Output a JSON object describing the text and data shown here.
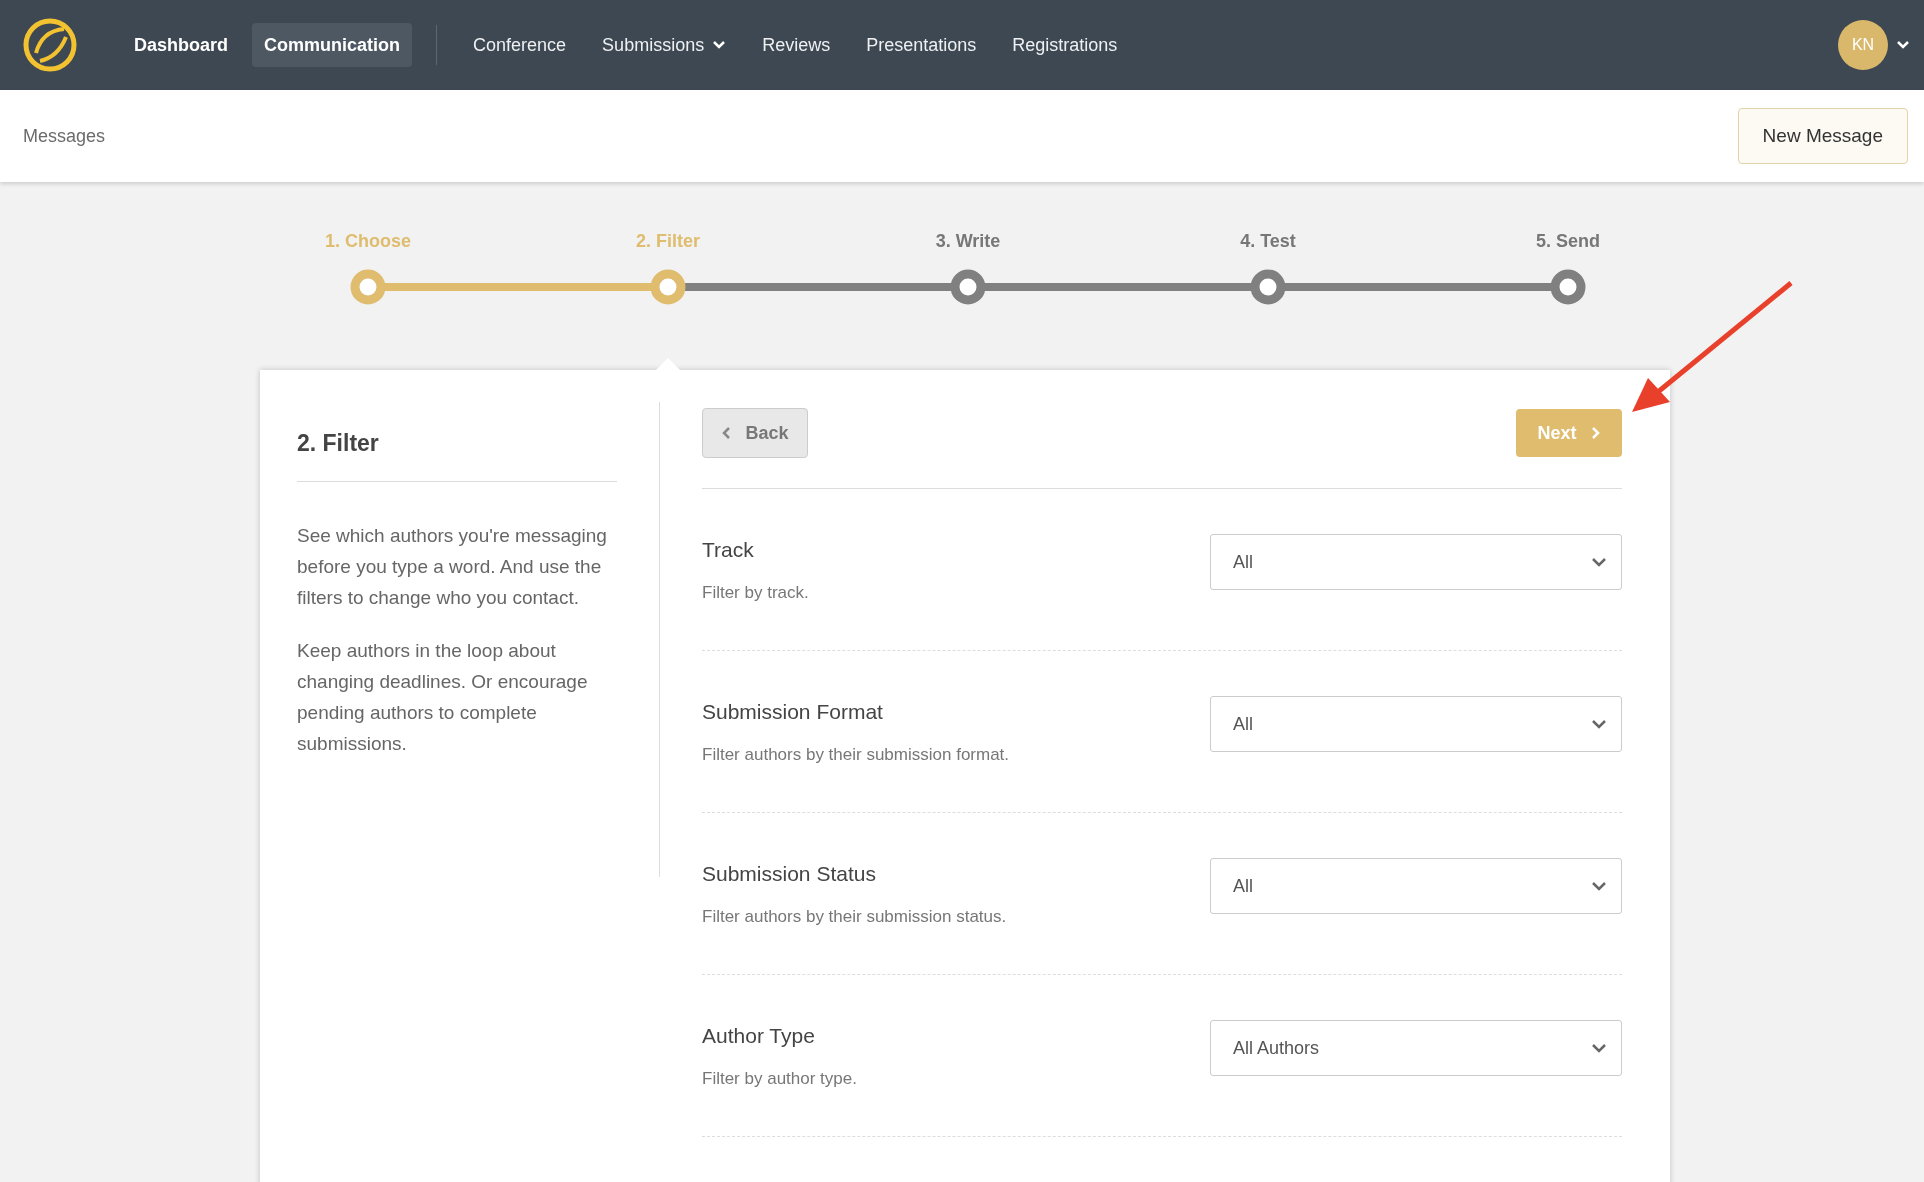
{
  "nav": {
    "items": [
      {
        "label": "Dashboard",
        "selected": false,
        "has_menu": false
      },
      {
        "label": "Communication",
        "selected": true,
        "has_menu": false
      },
      {
        "label": "Conference",
        "selected": false,
        "has_menu": false
      },
      {
        "label": "Submissions",
        "selected": false,
        "has_menu": true
      },
      {
        "label": "Reviews",
        "selected": false,
        "has_menu": false
      },
      {
        "label": "Presentations",
        "selected": false,
        "has_menu": false
      },
      {
        "label": "Registrations",
        "selected": false,
        "has_menu": false
      }
    ],
    "avatar": "KN"
  },
  "header": {
    "title": "Messages",
    "button": "New Message"
  },
  "steps": [
    {
      "label": "1. Choose",
      "reached": true
    },
    {
      "label": "2. Filter",
      "reached": true
    },
    {
      "label": "3. Write",
      "reached": false
    },
    {
      "label": "4. Test",
      "reached": false
    },
    {
      "label": "5. Send",
      "reached": false
    }
  ],
  "panel": {
    "title": "2. Filter",
    "paragraphs": [
      "See which authors you're messaging before you type a word. And use the filters to change who you contact.",
      "Keep authors in the loop about changing deadlines. Or encourage pending authors to complete submissions."
    ]
  },
  "actions": {
    "back": "Back",
    "next": "Next"
  },
  "filters": [
    {
      "label": "Track",
      "description": "Filter by track.",
      "value": "All"
    },
    {
      "label": "Submission Format",
      "description": "Filter authors by their submission format.",
      "value": "All"
    },
    {
      "label": "Submission Status",
      "description": "Filter authors by their submission status.",
      "value": "All"
    },
    {
      "label": "Author Type",
      "description": "Filter by author type.",
      "value": "All Authors"
    }
  ]
}
